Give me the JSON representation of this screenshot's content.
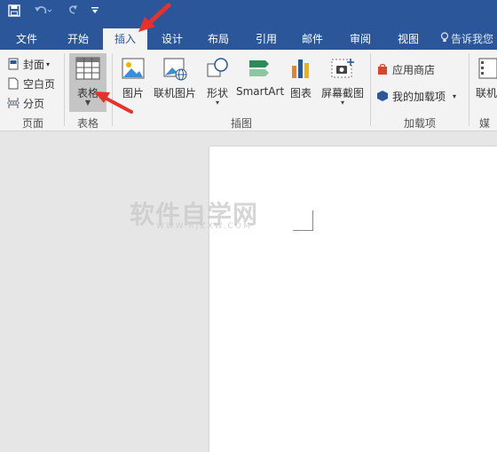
{
  "title_bar": {
    "qat_icons": [
      "save-icon",
      "undo-icon",
      "redo-icon",
      "customize-qat-icon"
    ]
  },
  "tabs": [
    {
      "label": "文件"
    },
    {
      "label": "开始"
    },
    {
      "label": "插入"
    },
    {
      "label": "设计"
    },
    {
      "label": "布局"
    },
    {
      "label": "引用"
    },
    {
      "label": "邮件"
    },
    {
      "label": "审阅"
    },
    {
      "label": "视图"
    }
  ],
  "tell_me": "告诉我您",
  "ribbon": {
    "pages": {
      "cover": "封面",
      "blank": "空白页",
      "break": "分页",
      "group": "页面"
    },
    "tables": {
      "table": "表格",
      "group": "表格"
    },
    "illustrations": {
      "picture": "图片",
      "online_picture": "联机图片",
      "shapes": "形状",
      "smartart": "SmartArt",
      "chart": "图表",
      "screenshot": "屏幕截图",
      "group": "插图"
    },
    "addins": {
      "store": "应用商店",
      "my_addins": "我的加载项",
      "group": "加载项"
    },
    "media": {
      "online_video": "联机",
      "group": "媒"
    }
  },
  "watermark": {
    "text": "软件自学网",
    "sub": "WWW.RJZXW.COM"
  },
  "colors": {
    "accent": "#2b579a",
    "arrow": "#e8312b"
  }
}
